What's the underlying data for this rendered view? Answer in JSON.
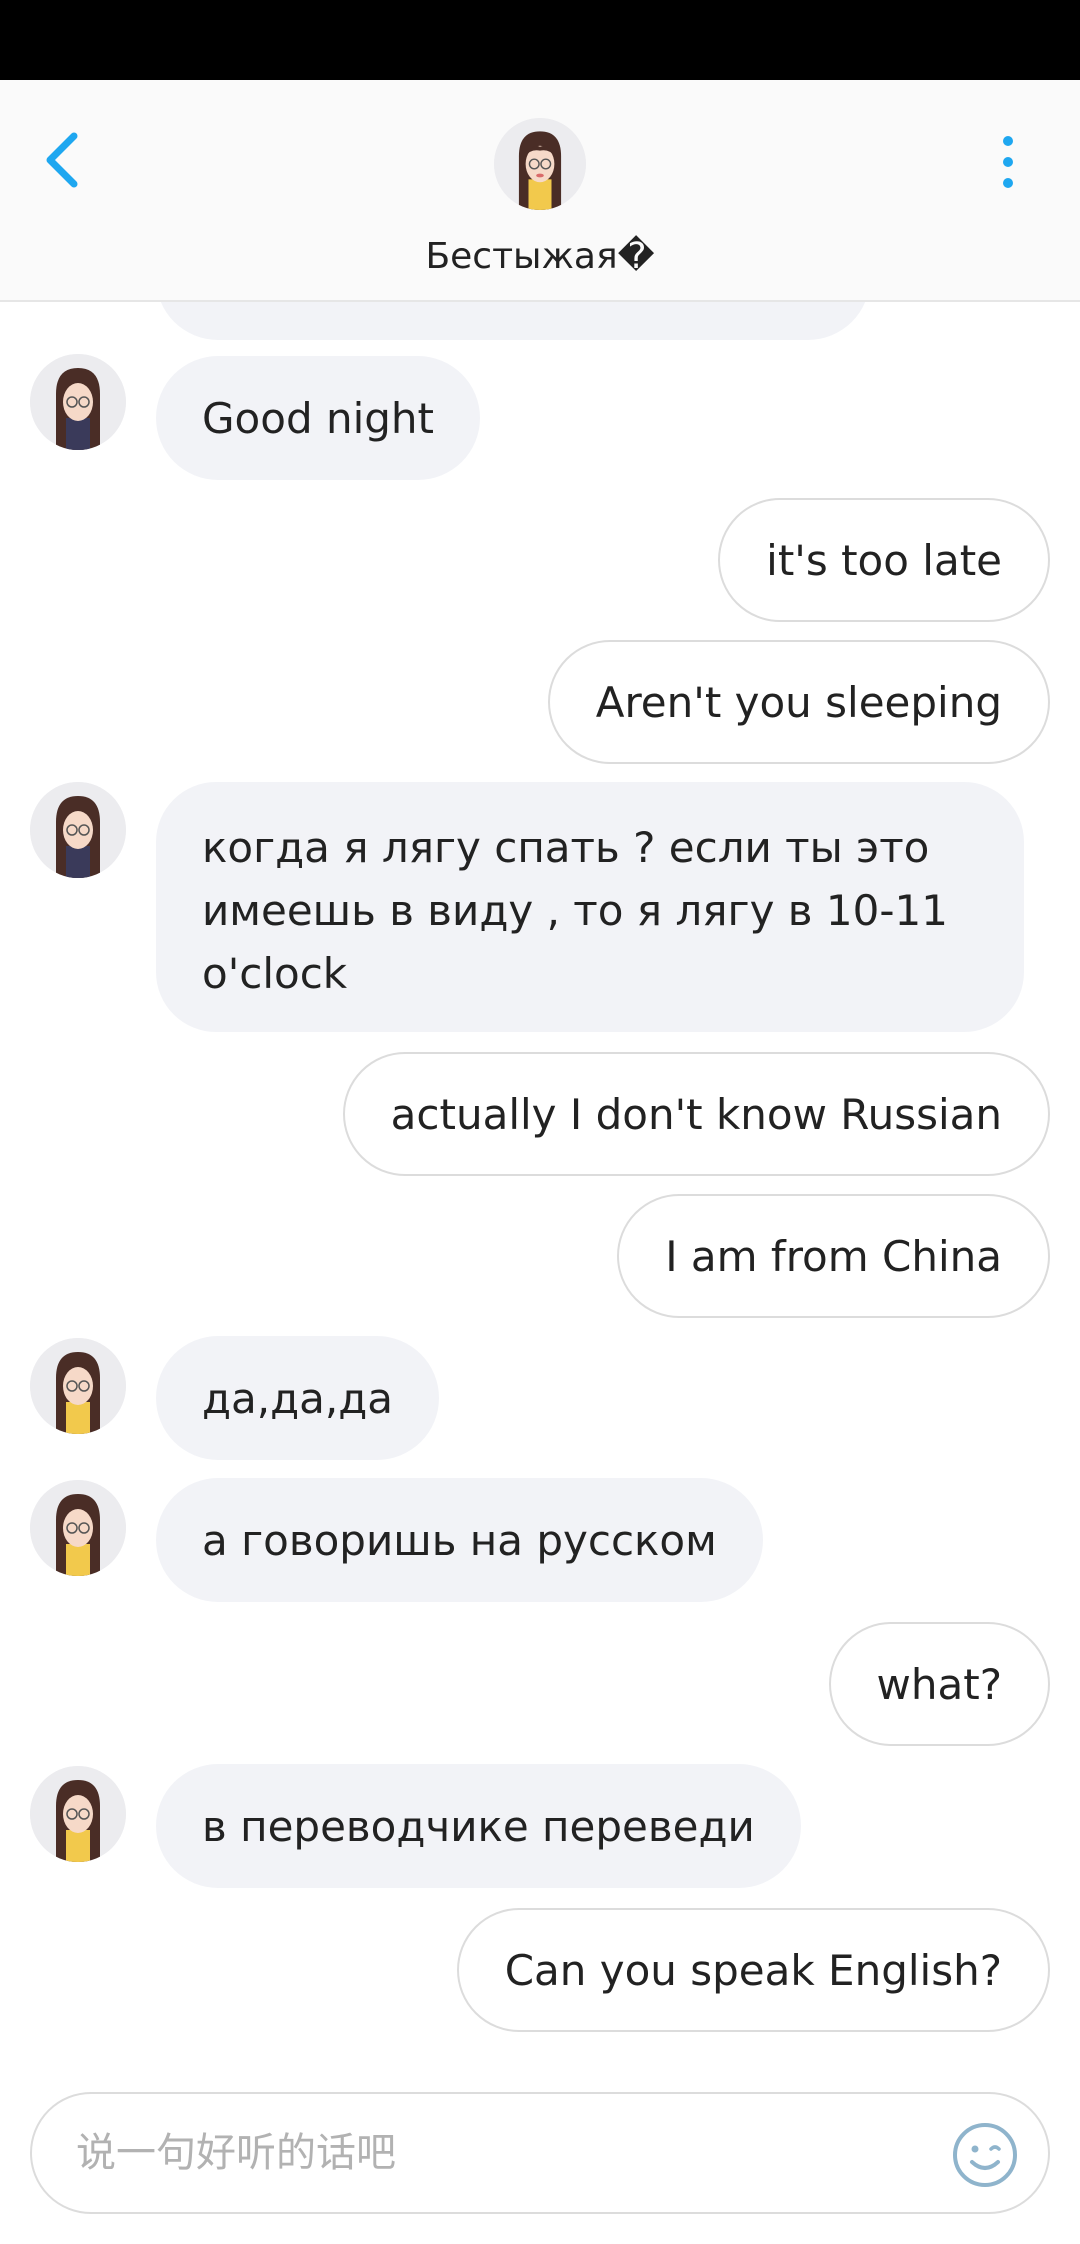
{
  "header": {
    "title": "Бестыжая�",
    "accent": "#1ea7f0"
  },
  "messages": [
    {
      "side": "in",
      "text": "Good night"
    },
    {
      "side": "out",
      "text": "it's too late"
    },
    {
      "side": "out",
      "text": "Aren't you sleeping"
    },
    {
      "side": "in",
      "text": "когда я лягу спать ? если ты это имеешь в виду , то я лягу в 10-11 o'clock"
    },
    {
      "side": "out",
      "text": "actually I don't know Russian"
    },
    {
      "side": "out",
      "text": "I am from China"
    },
    {
      "side": "in",
      "text": "да,да,да"
    },
    {
      "side": "in",
      "text": "а говоришь на русском"
    },
    {
      "side": "out",
      "text": "what?"
    },
    {
      "side": "in",
      "text": "в переводчике переведи"
    },
    {
      "side": "out",
      "text": "Can you speak English?"
    }
  ],
  "composer": {
    "placeholder": "说一句好听的话吧",
    "emoji_icon": "smile-emoji-icon"
  },
  "icons": {
    "back": "chevron-left-icon",
    "more": "more-vertical-icon"
  }
}
